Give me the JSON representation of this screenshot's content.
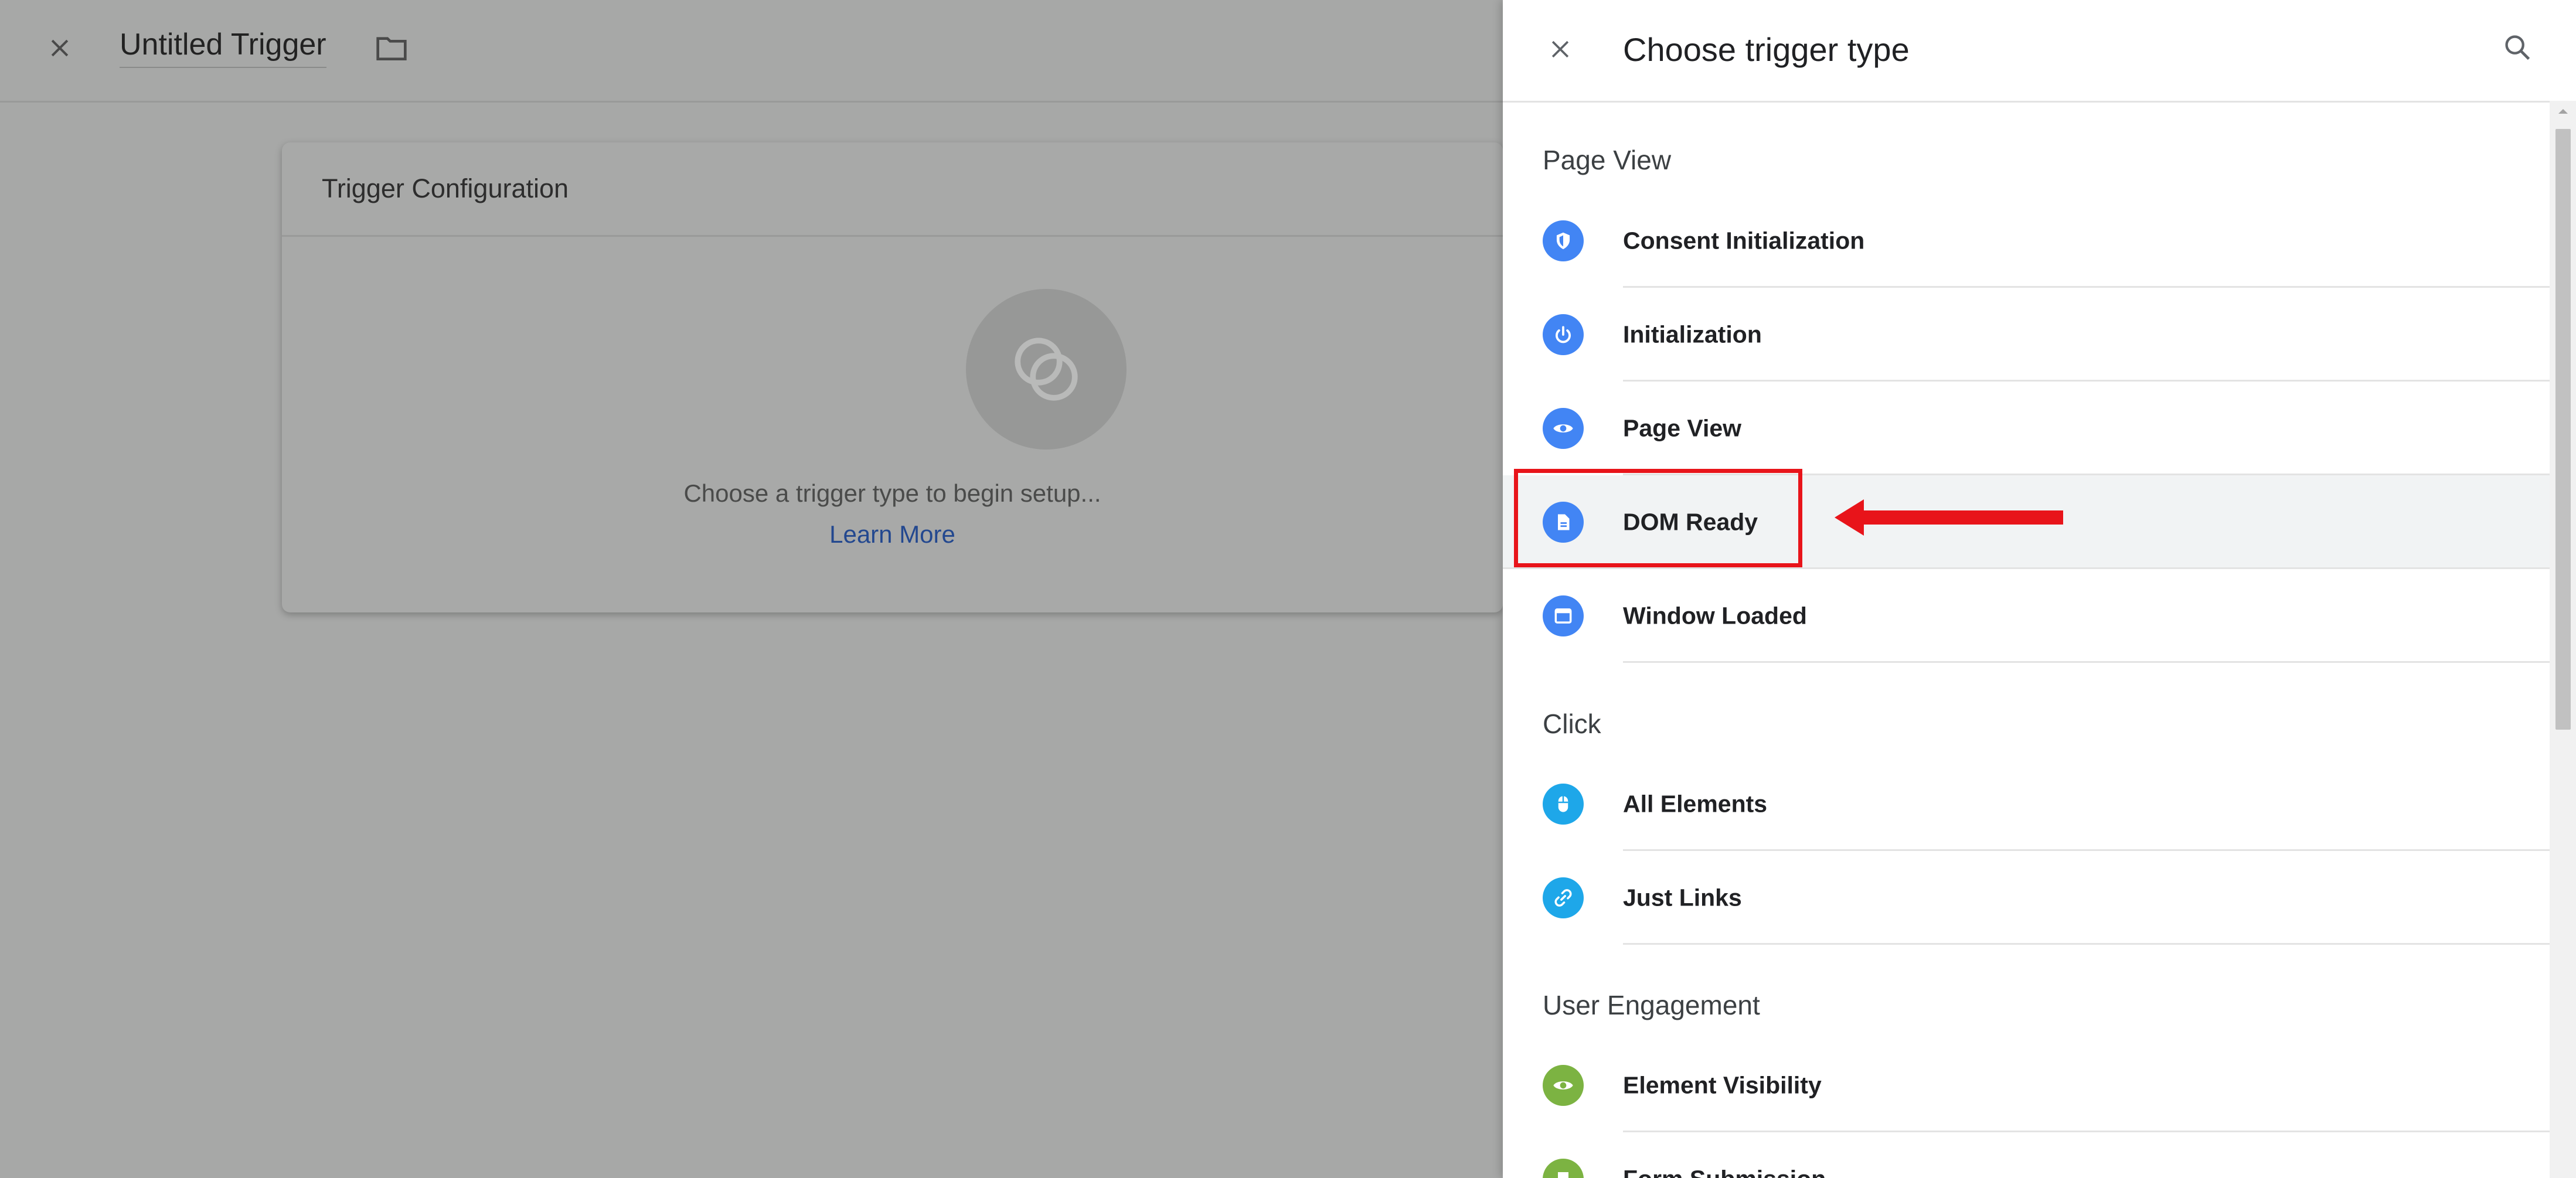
{
  "editor": {
    "title": "Untitled Trigger",
    "config_card": {
      "heading": "Trigger Configuration",
      "prompt": "Choose a trigger type to begin setup...",
      "learn_more": "Learn More"
    }
  },
  "panel": {
    "title": "Choose trigger type",
    "sections": [
      {
        "title": "Page View",
        "items": [
          {
            "label": "Consent Initialization",
            "icon": "shield-icon",
            "color": "#4285f4"
          },
          {
            "label": "Initialization",
            "icon": "power-icon",
            "color": "#4285f4"
          },
          {
            "label": "Page View",
            "icon": "eye-icon",
            "color": "#4285f4"
          },
          {
            "label": "DOM Ready",
            "icon": "document-icon",
            "color": "#4285f4",
            "highlighted": true
          },
          {
            "label": "Window Loaded",
            "icon": "window-icon",
            "color": "#4285f4"
          }
        ]
      },
      {
        "title": "Click",
        "items": [
          {
            "label": "All Elements",
            "icon": "mouse-icon",
            "color": "#1ea7e9"
          },
          {
            "label": "Just Links",
            "icon": "link-icon",
            "color": "#1ea7e9"
          }
        ]
      },
      {
        "title": "User Engagement",
        "items": [
          {
            "label": "Element Visibility",
            "icon": "eye-icon",
            "color": "#7cb342"
          },
          {
            "label": "Form Submission",
            "icon": "form-icon",
            "color": "#7cb342"
          }
        ]
      }
    ]
  },
  "colors": {
    "annotation": "#e8141a",
    "highlight_row": "#f1f3f4",
    "link": "#23488f"
  }
}
